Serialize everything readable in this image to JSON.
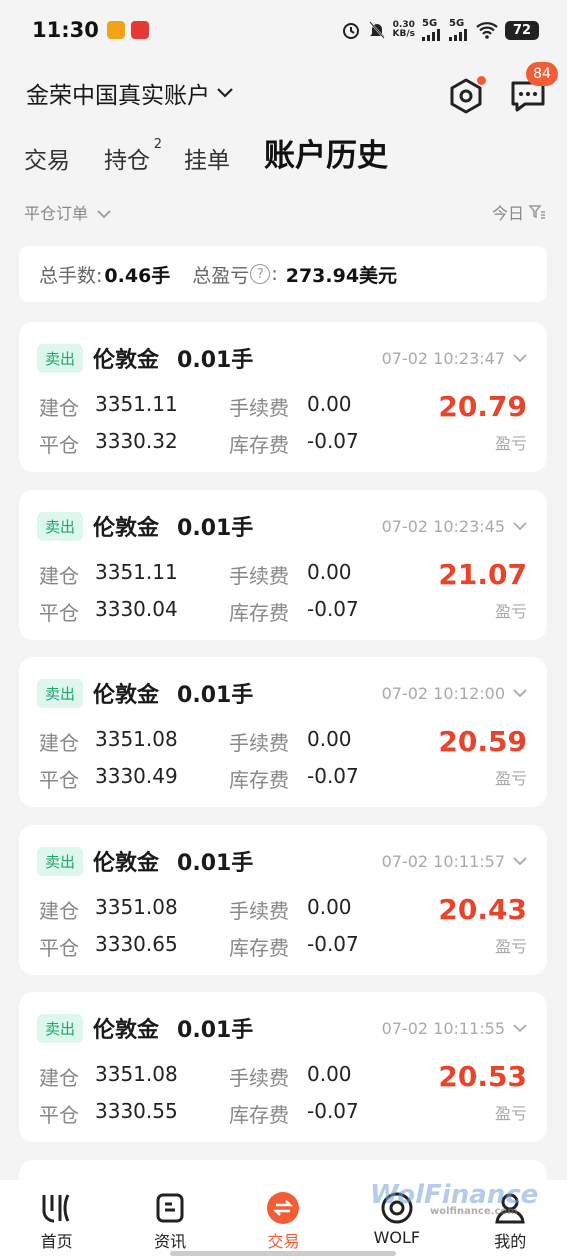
{
  "status_bar": {
    "time": "11:30",
    "speed_top": "0.30",
    "speed_unit": "KB/s",
    "net1": "5G",
    "net2": "5G",
    "battery": "72"
  },
  "header": {
    "account": "金荣中国真实账户",
    "message_badge": "84"
  },
  "tabs": [
    {
      "label": "交易"
    },
    {
      "label": "持仓",
      "count": "2"
    },
    {
      "label": "挂单"
    },
    {
      "label": "账户历史"
    }
  ],
  "filter": {
    "left": "平仓订单",
    "right": "今日"
  },
  "summary": {
    "lots_label": "总手数:",
    "lots_value": "0.46手",
    "pnl_label": "总盈亏",
    "pnl_colon": ":",
    "pnl_value": "273.94美元"
  },
  "labels": {
    "tag": "卖出",
    "open": "建仓",
    "close": "平仓",
    "fee": "手续费",
    "swap": "库存费",
    "pnl": "盈亏"
  },
  "orders": [
    {
      "symbol": "伦敦金",
      "lot": "0.01手",
      "time": "07-02 10:23:47",
      "open": "3351.11",
      "close": "3330.32",
      "fee": "0.00",
      "swap": "-0.07",
      "pnl": "20.79"
    },
    {
      "symbol": "伦敦金",
      "lot": "0.01手",
      "time": "07-02 10:23:45",
      "open": "3351.11",
      "close": "3330.04",
      "fee": "0.00",
      "swap": "-0.07",
      "pnl": "21.07"
    },
    {
      "symbol": "伦敦金",
      "lot": "0.01手",
      "time": "07-02 10:12:00",
      "open": "3351.08",
      "close": "3330.49",
      "fee": "0.00",
      "swap": "-0.07",
      "pnl": "20.59"
    },
    {
      "symbol": "伦敦金",
      "lot": "0.01手",
      "time": "07-02 10:11:57",
      "open": "3351.08",
      "close": "3330.65",
      "fee": "0.00",
      "swap": "-0.07",
      "pnl": "20.43"
    },
    {
      "symbol": "伦敦金",
      "lot": "0.01手",
      "time": "07-02 10:11:55",
      "open": "3351.08",
      "close": "3330.55",
      "fee": "0.00",
      "swap": "-0.07",
      "pnl": "20.53"
    }
  ],
  "nav": [
    {
      "label": "首页",
      "icon": "home-logo-icon"
    },
    {
      "label": "资讯",
      "icon": "news-icon"
    },
    {
      "label": "交易",
      "icon": "trade-icon"
    },
    {
      "label": "WOLF",
      "icon": "wolf-icon"
    },
    {
      "label": "我的",
      "icon": "profile-icon"
    }
  ],
  "watermark": {
    "brand": "WolFinance",
    "url": "wolfinance.com"
  },
  "colors": {
    "accent": "#f25d36",
    "profit": "#e8442c",
    "sell_tag_bg": "#def7ec",
    "sell_tag_text": "#1ca86b"
  }
}
